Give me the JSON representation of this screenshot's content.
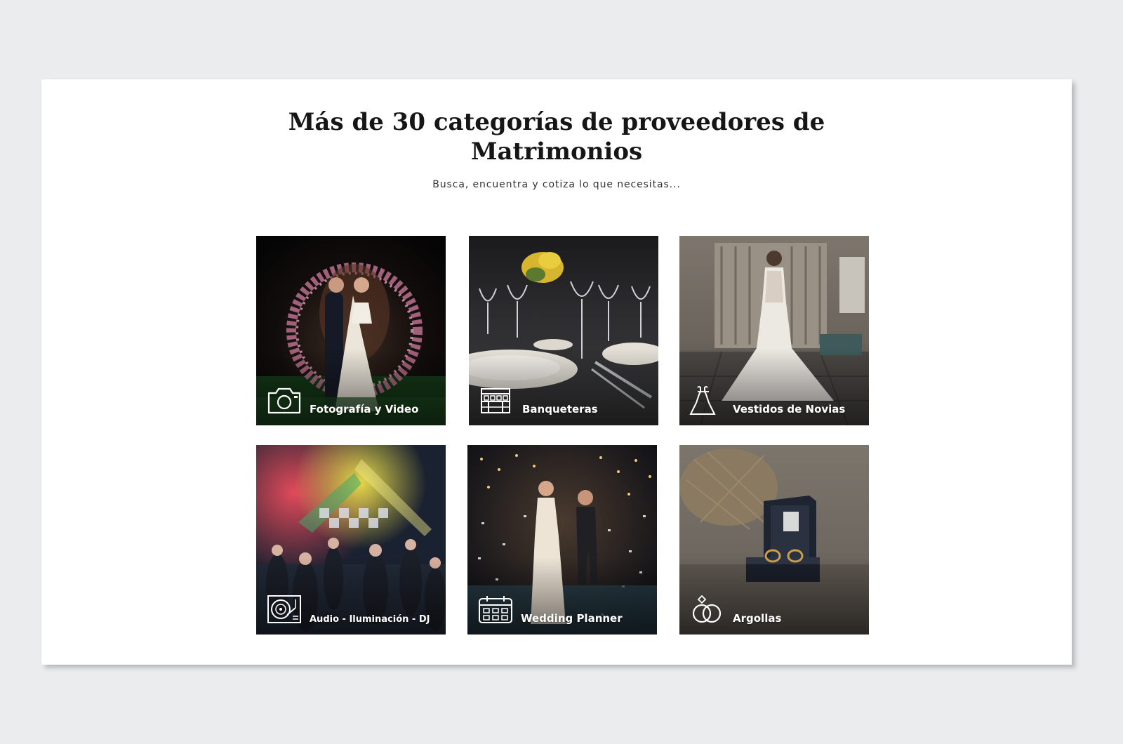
{
  "section": {
    "title_line1": "Más de 30 categorías de proveedores de",
    "title_line2": "Matrimonios",
    "subtitle": "Busca, encuentra y cotiza lo que necesitas..."
  },
  "categories": [
    {
      "label": "Fotografía y Video",
      "icon": "camera-icon"
    },
    {
      "label": "Banqueteras",
      "icon": "catering-stand-icon"
    },
    {
      "label": "Vestidos de Novias",
      "icon": "dress-icon"
    },
    {
      "label": "Audio - Iluminación - DJ",
      "icon": "turntable-icon"
    },
    {
      "label": "Wedding Planner",
      "icon": "planner-calendar-icon"
    },
    {
      "label": "Argollas",
      "icon": "wedding-rings-icon"
    }
  ],
  "colors": {
    "page_background": "#ebecee",
    "card_background": "#ffffff",
    "title_text": "#161616",
    "subtitle_text": "#333333",
    "label_text": "#ffffff"
  }
}
